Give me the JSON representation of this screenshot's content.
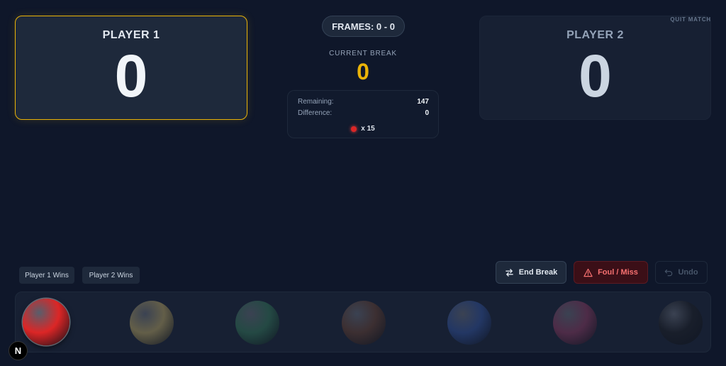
{
  "player1": {
    "name": "PLAYER 1",
    "score": "0",
    "highlight_color": "#eab308"
  },
  "player2": {
    "name": "PLAYER 2",
    "score": "0"
  },
  "quit_label": "QUIT MATCH",
  "frames": {
    "text": "FRAMES: 0 - 0"
  },
  "current_break": {
    "label": "CURRENT BREAK",
    "value": "0",
    "color": "#eab308"
  },
  "stats": {
    "remaining_label": "Remaining:",
    "remaining_value": "147",
    "difference_label": "Difference:",
    "difference_value": "0",
    "reds_text": "x 15"
  },
  "controls": {
    "player1_wins": "Player 1 Wins",
    "player2_wins": "Player 2 Wins",
    "end_break": "End Break",
    "foul_miss": "Foul / Miss",
    "undo": "Undo"
  },
  "balls": [
    {
      "name": "red",
      "color": "#dc2626",
      "enabled": true
    },
    {
      "name": "yellow",
      "color": "#a1915a",
      "enabled": false
    },
    {
      "name": "green",
      "color": "#2f6b52",
      "enabled": false
    },
    {
      "name": "brown",
      "color": "#5a3b30",
      "enabled": false
    },
    {
      "name": "blue",
      "color": "#2d4a8c",
      "enabled": false
    },
    {
      "name": "pink",
      "color": "#7a3558",
      "enabled": false
    },
    {
      "name": "black",
      "color": "#1a1d24",
      "enabled": false
    }
  ],
  "dev_badge": "N"
}
